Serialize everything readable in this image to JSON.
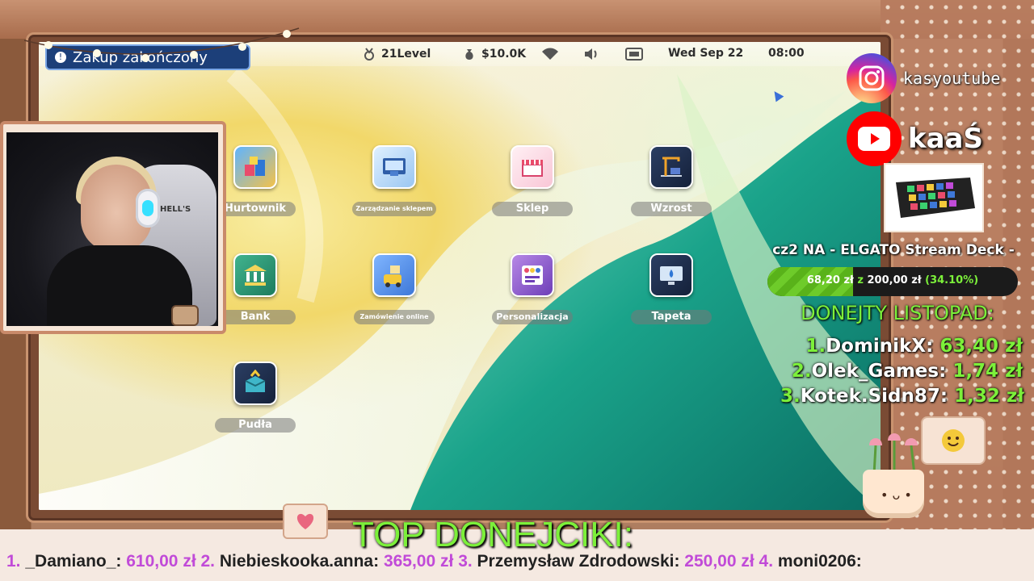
{
  "notification": {
    "text": "Zakup zakończony",
    "badge": "!"
  },
  "taskbar": {
    "level": "21Level",
    "money": "$10.0K",
    "date": "Wed Sep 22",
    "time": "08:00"
  },
  "desktop_icons": [
    {
      "label": "Hurtownik",
      "icon": "wholesale-icon",
      "size": "normal"
    },
    {
      "label": "Zarządzanie sklepem",
      "icon": "store-management-icon",
      "size": "small"
    },
    {
      "label": "Sklep",
      "icon": "shop-icon",
      "size": "normal"
    },
    {
      "label": "Wzrost",
      "icon": "growth-icon",
      "size": "normal"
    },
    {
      "label": "Bank",
      "icon": "bank-icon",
      "size": "normal"
    },
    {
      "label": "Zamówienie online",
      "icon": "online-order-icon",
      "size": "small"
    },
    {
      "label": "Personalizacja",
      "icon": "personalization-icon",
      "size": "mid"
    },
    {
      "label": "Tapeta",
      "icon": "wallpaper-icon",
      "size": "normal"
    },
    {
      "label": "Pudła",
      "icon": "boxes-icon",
      "size": "normal"
    }
  ],
  "social": {
    "instagram": "kasyoutube",
    "youtube": "kaaŚ"
  },
  "goal": {
    "title": "cz2 NA - ELGATO Stream Deck -",
    "current": "68,20 zł",
    "separator": "z",
    "target": "200,00 zł",
    "percent_text": "(34.10%)",
    "fraction": 0.341
  },
  "donations_month": {
    "title": "DONEJTY LISTOPAD:",
    "rows": [
      {
        "rank": "1.",
        "name": "DominikX:",
        "amount": "63,40 zł"
      },
      {
        "rank": "2.",
        "name": "Olek_Games:",
        "amount": "1,74 zł"
      },
      {
        "rank": "3.",
        "name": "Kotek.Sidn87:",
        "amount": "1,32 zł"
      }
    ]
  },
  "top_donors": {
    "title": "TOP DONEJCIKI:",
    "entries": [
      {
        "rank": "1.",
        "name": "_Damiano_:",
        "amount": "610,00 zł"
      },
      {
        "rank": "2.",
        "name": "Niebieskooka.anna:",
        "amount": "365,00 zł"
      },
      {
        "rank": "3.",
        "name": "Przemysław Zdrodowski:",
        "amount": "250,00 zł"
      },
      {
        "rank": "4.",
        "name": "moni0206:",
        "amount": ""
      }
    ]
  },
  "webcam": {
    "chair_logo": "HELL'S"
  },
  "colors": {
    "accent_green": "#7cf03a",
    "accent_purple": "#c14bd8",
    "notification_blue": "#1c3f79"
  }
}
